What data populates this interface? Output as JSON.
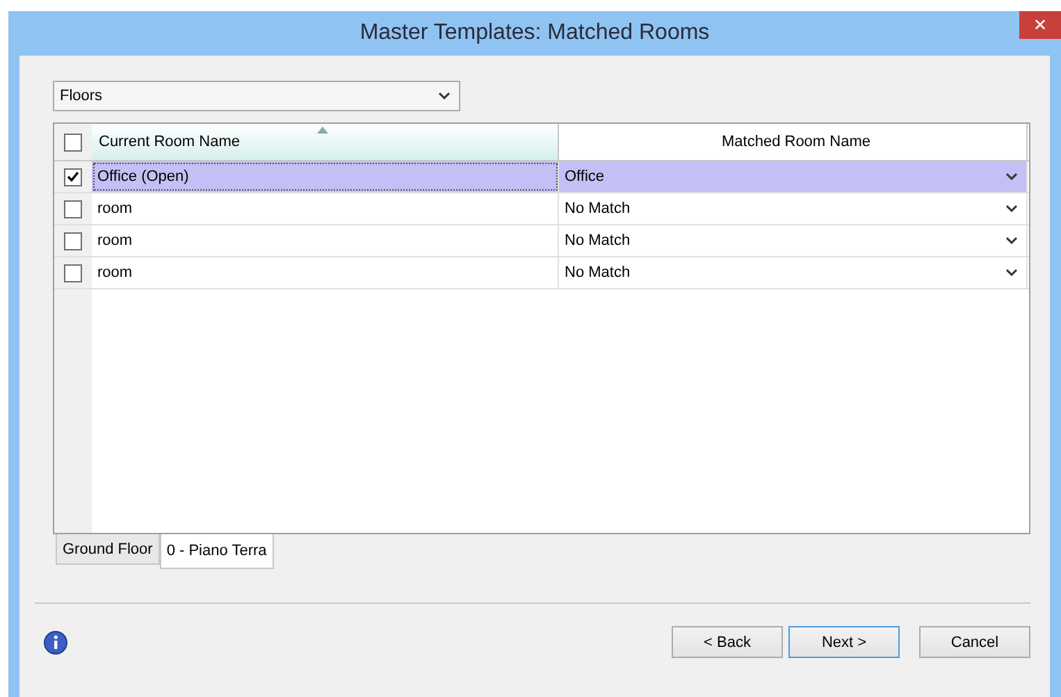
{
  "window": {
    "title": "Master Templates: Matched Rooms",
    "close": "✕"
  },
  "level_select": {
    "value": "Floors"
  },
  "table": {
    "select_all": {
      "checked": false
    },
    "columns": [
      {
        "label": "Current Room Name",
        "sorted": true
      },
      {
        "label": "Matched Room Name",
        "sorted": false
      }
    ],
    "rows": [
      {
        "checked": true,
        "selected": true,
        "current": "Office (Open)",
        "matched": "Office"
      },
      {
        "checked": false,
        "selected": false,
        "current": "room",
        "matched": "No Match"
      },
      {
        "checked": false,
        "selected": false,
        "current": "room",
        "matched": "No Match"
      },
      {
        "checked": false,
        "selected": false,
        "current": "room",
        "matched": "No Match"
      }
    ]
  },
  "tabs": [
    {
      "label": "Ground Floor",
      "selected": false
    },
    {
      "label": "0 - Piano Terra",
      "selected": true
    }
  ],
  "buttons": [
    {
      "label": "< Back",
      "default": false
    },
    {
      "label": "Next >",
      "default": true
    },
    {
      "label": "Cancel",
      "default": false
    }
  ]
}
